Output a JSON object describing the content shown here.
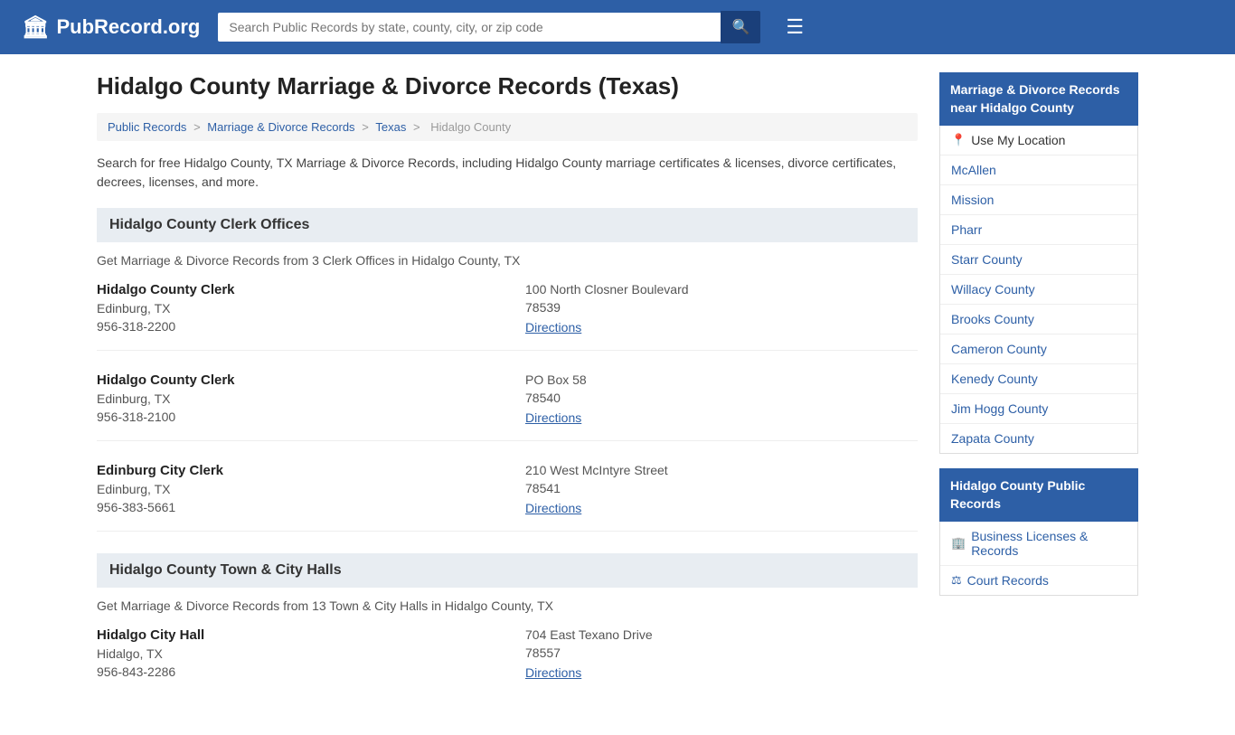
{
  "header": {
    "logo_icon": "🏛",
    "logo_text": "PubRecord.org",
    "search_placeholder": "Search Public Records by state, county, city, or zip code",
    "search_icon": "🔍",
    "menu_icon": "☰"
  },
  "page": {
    "title": "Hidalgo County Marriage & Divorce Records (Texas)",
    "description": "Search for free Hidalgo County, TX Marriage & Divorce Records, including Hidalgo County marriage certificates & licenses, divorce certificates, decrees, licenses, and more."
  },
  "breadcrumb": {
    "items": [
      "Public Records",
      "Marriage & Divorce Records",
      "Texas",
      "Hidalgo County"
    ],
    "separators": [
      ">",
      ">",
      ">"
    ]
  },
  "clerk_section": {
    "heading": "Hidalgo County Clerk Offices",
    "description": "Get Marriage & Divorce Records from 3 Clerk Offices in Hidalgo County, TX",
    "offices": [
      {
        "name": "Hidalgo County Clerk",
        "city": "Edinburg, TX",
        "phone": "956-318-2200",
        "address": "100 North Closner Boulevard",
        "zip": "78539",
        "directions_label": "Directions"
      },
      {
        "name": "Hidalgo County Clerk",
        "city": "Edinburg, TX",
        "phone": "956-318-2100",
        "address": "PO Box 58",
        "zip": "78540",
        "directions_label": "Directions"
      },
      {
        "name": "Edinburg City Clerk",
        "city": "Edinburg, TX",
        "phone": "956-383-5661",
        "address": "210 West McIntyre Street",
        "zip": "78541",
        "directions_label": "Directions"
      }
    ]
  },
  "city_hall_section": {
    "heading": "Hidalgo County Town & City Halls",
    "description": "Get Marriage & Divorce Records from 13 Town & City Halls in Hidalgo County, TX",
    "offices": [
      {
        "name": "Hidalgo City Hall",
        "city": "Hidalgo, TX",
        "phone": "956-843-2286",
        "address": "704 East Texano Drive",
        "zip": "78557",
        "directions_label": "Directions"
      }
    ]
  },
  "sidebar": {
    "nearby_title": "Marriage & Divorce Records near Hidalgo County",
    "nearby_items": [
      {
        "label": "Use My Location",
        "icon": "📍",
        "type": "location"
      },
      {
        "label": "McAllen",
        "type": "city"
      },
      {
        "label": "Mission",
        "type": "city"
      },
      {
        "label": "Pharr",
        "type": "city"
      },
      {
        "label": "Starr County",
        "type": "county"
      },
      {
        "label": "Willacy County",
        "type": "county"
      },
      {
        "label": "Brooks County",
        "type": "county"
      },
      {
        "label": "Cameron County",
        "type": "county"
      },
      {
        "label": "Kenedy County",
        "type": "county"
      },
      {
        "label": "Jim Hogg County",
        "type": "county"
      },
      {
        "label": "Zapata County",
        "type": "county"
      }
    ],
    "public_records_title": "Hidalgo County Public Records",
    "public_records_items": [
      {
        "label": "Business Licenses & Records",
        "icon": "🏢"
      },
      {
        "label": "Court Records",
        "icon": "⚖"
      }
    ]
  }
}
